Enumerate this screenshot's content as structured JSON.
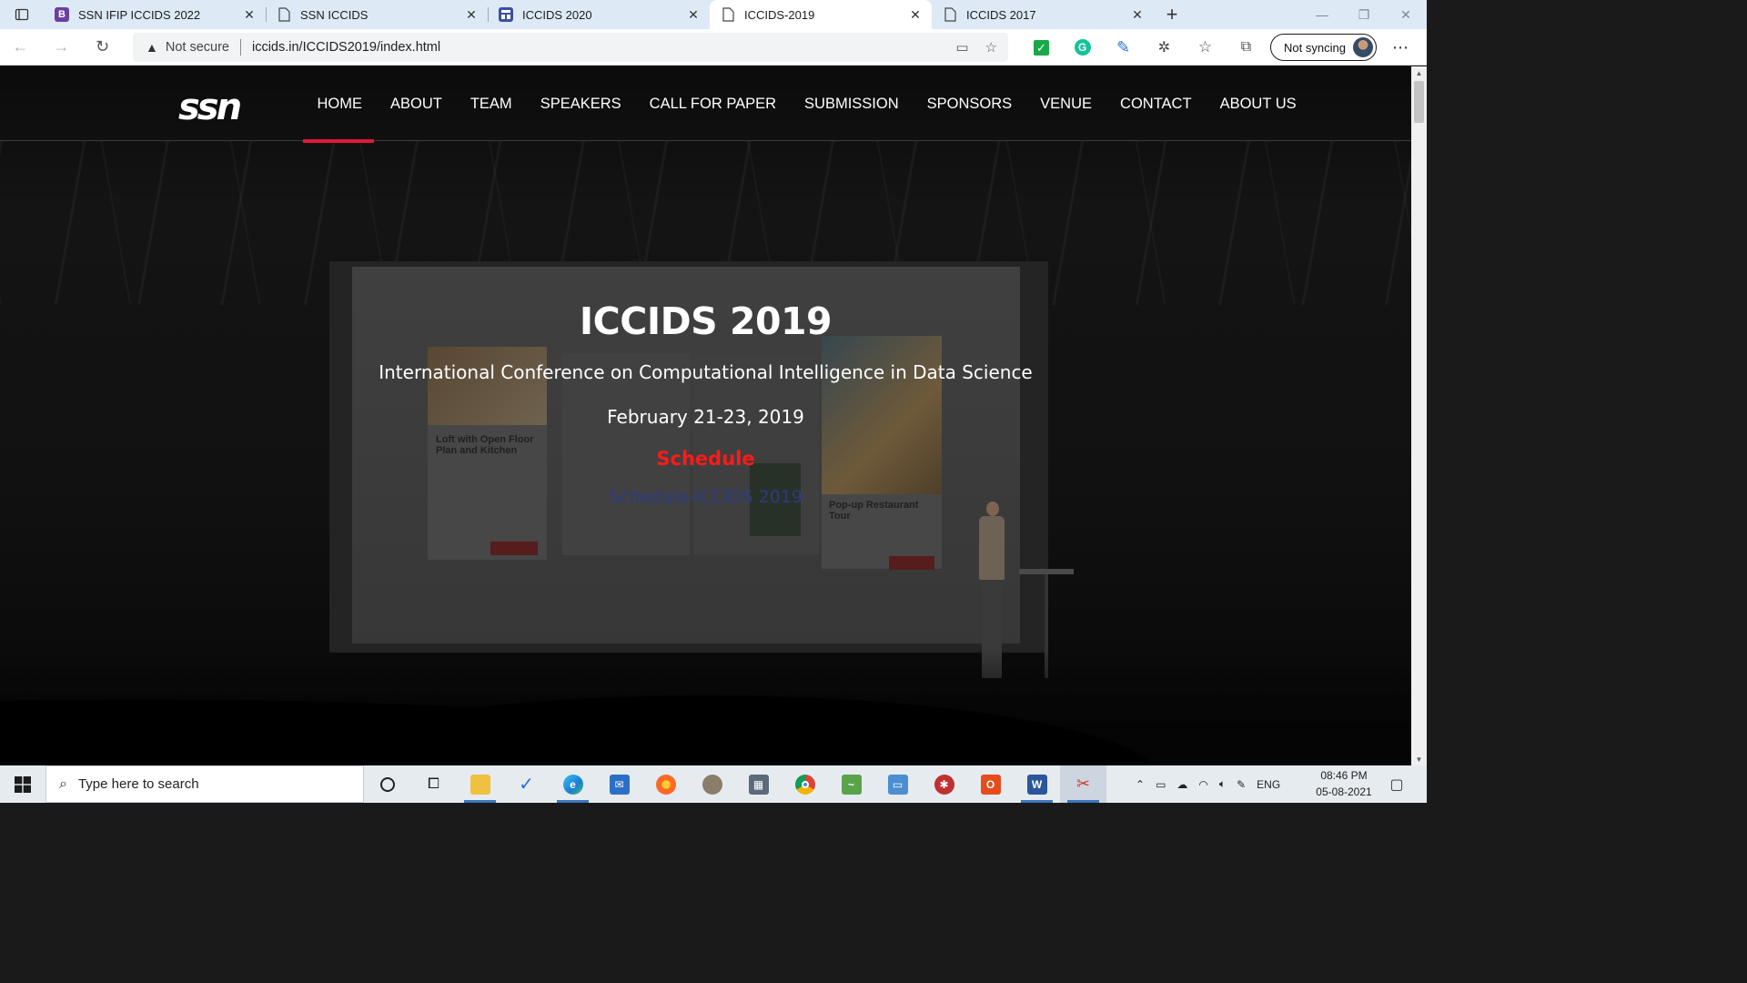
{
  "browser": {
    "tabs": [
      {
        "title": "SSN IFIP ICCIDS 2022",
        "favicon": "bootstrap-b-icon",
        "active": false
      },
      {
        "title": "SSN ICCIDS",
        "favicon": "page-icon",
        "active": false
      },
      {
        "title": "ICCIDS 2020",
        "favicon": "site-grid-icon",
        "active": false
      },
      {
        "title": "ICCIDS-2019",
        "favicon": "page-icon",
        "active": true
      },
      {
        "title": "ICCIDS 2017",
        "favicon": "page-icon",
        "active": false
      }
    ],
    "address": {
      "security_label": "Not secure",
      "url": "iccids.in/ICCIDS2019/index.html"
    },
    "sync_label": "Not syncing"
  },
  "site": {
    "logo_text": "ssn",
    "menu": [
      "HOME",
      "ABOUT",
      "TEAM",
      "SPEAKERS",
      "CALL FOR PAPER",
      "SUBMISSION",
      "SPONSORS",
      "VENUE",
      "CONTACT",
      "ABOUT US"
    ],
    "active_menu": "HOME",
    "accent_color": "#e3173a"
  },
  "hero": {
    "title": "ICCIDS 2019",
    "subtitle": "International Conference on Computational Intelligence in Data Science",
    "date": "February 21-23, 2019",
    "schedule_heading": "Schedule",
    "schedule_link": "Schedule-ICCIDS 2019"
  },
  "slide_cards": {
    "card1": "Loft with Open Floor Plan and Kitchen",
    "card2": "Pop-up Restaurant Tour"
  },
  "taskbar": {
    "search_placeholder": "Type here to search",
    "language": "ENG",
    "time": "08:46 PM",
    "date": "05-08-2021"
  }
}
